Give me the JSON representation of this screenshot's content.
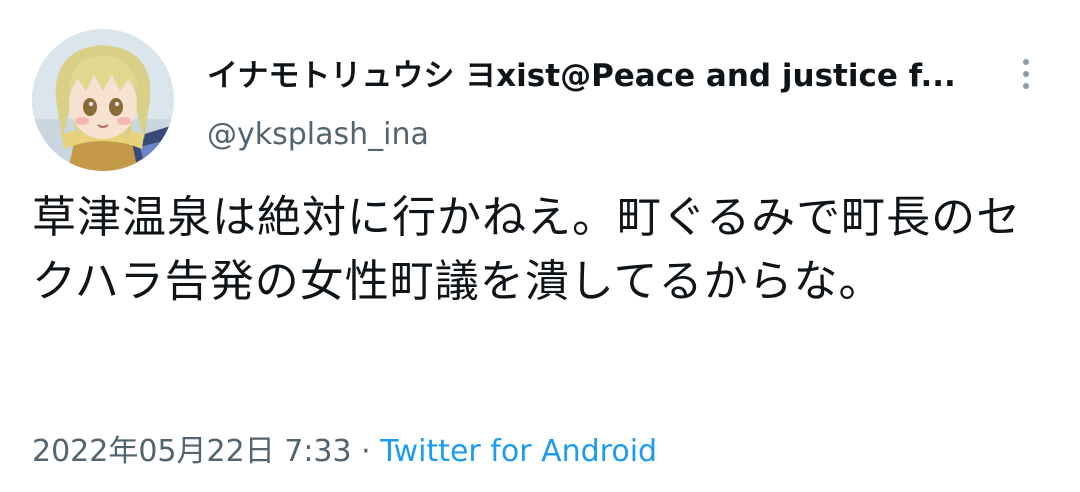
{
  "user": {
    "display_name": "イナモトリュウシ ヨxist@Peace and justice f...",
    "handle": "@yksplash_ina",
    "avatar": "anime-character-avatar"
  },
  "menu": {
    "icon": "more-vertical-icon"
  },
  "tweet": {
    "text": "草津温泉は絶対に行かねえ。町ぐるみで町長のセクハラ告発の女性町議を潰してるからな。",
    "timestamp": "2022年05月22日 7:33",
    "separator": " · ",
    "source": "Twitter for Android"
  },
  "colors": {
    "text": "#0f1419",
    "secondary": "#536471",
    "link": "#1d9bf0"
  }
}
